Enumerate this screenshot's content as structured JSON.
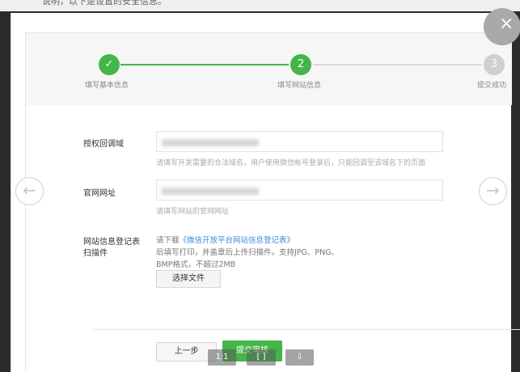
{
  "top_strip": {
    "text": "说明，以下是设置的安全信息。"
  },
  "viewer": {
    "close_label": "×",
    "prev_label": "←",
    "next_label": "→",
    "toolbar": {
      "zoom_label": "1:1",
      "fit_label": "[ ]",
      "save_label": "⇩"
    }
  },
  "steps": [
    {
      "number": "✓",
      "label": "填写基本信息",
      "state": "done"
    },
    {
      "number": "2",
      "label": "填写网站信息",
      "state": "active"
    },
    {
      "number": "3",
      "label": "提交成功",
      "state": "todo"
    }
  ],
  "form": {
    "callback_domain": {
      "label": "授权回调域",
      "hint": "请填写开发需要的合法域名，用户使用微信帐号登录后，只能回调至该域名下的页面"
    },
    "website_url": {
      "label": "官网网址",
      "hint": "请填写网站的官网网址"
    },
    "registration_form": {
      "label_line1": "网站信息登记表",
      "label_line2": "扫描件",
      "download_prefix": "请下载",
      "download_link": "《微信开放平台网站信息登记表》",
      "instruction_line1": "后填写打印，并盖章后上传扫描件。支持JPG、PNG、",
      "instruction_line2": "BMP格式，不超过2MB",
      "choose_file_label": "选择文件"
    }
  },
  "actions": {
    "prev_label": "上一步",
    "submit_label": "提交审核"
  },
  "colors": {
    "accent_green": "#44b549",
    "link_blue": "#3b8ae0",
    "inactive_gray": "#cfcfcf"
  }
}
